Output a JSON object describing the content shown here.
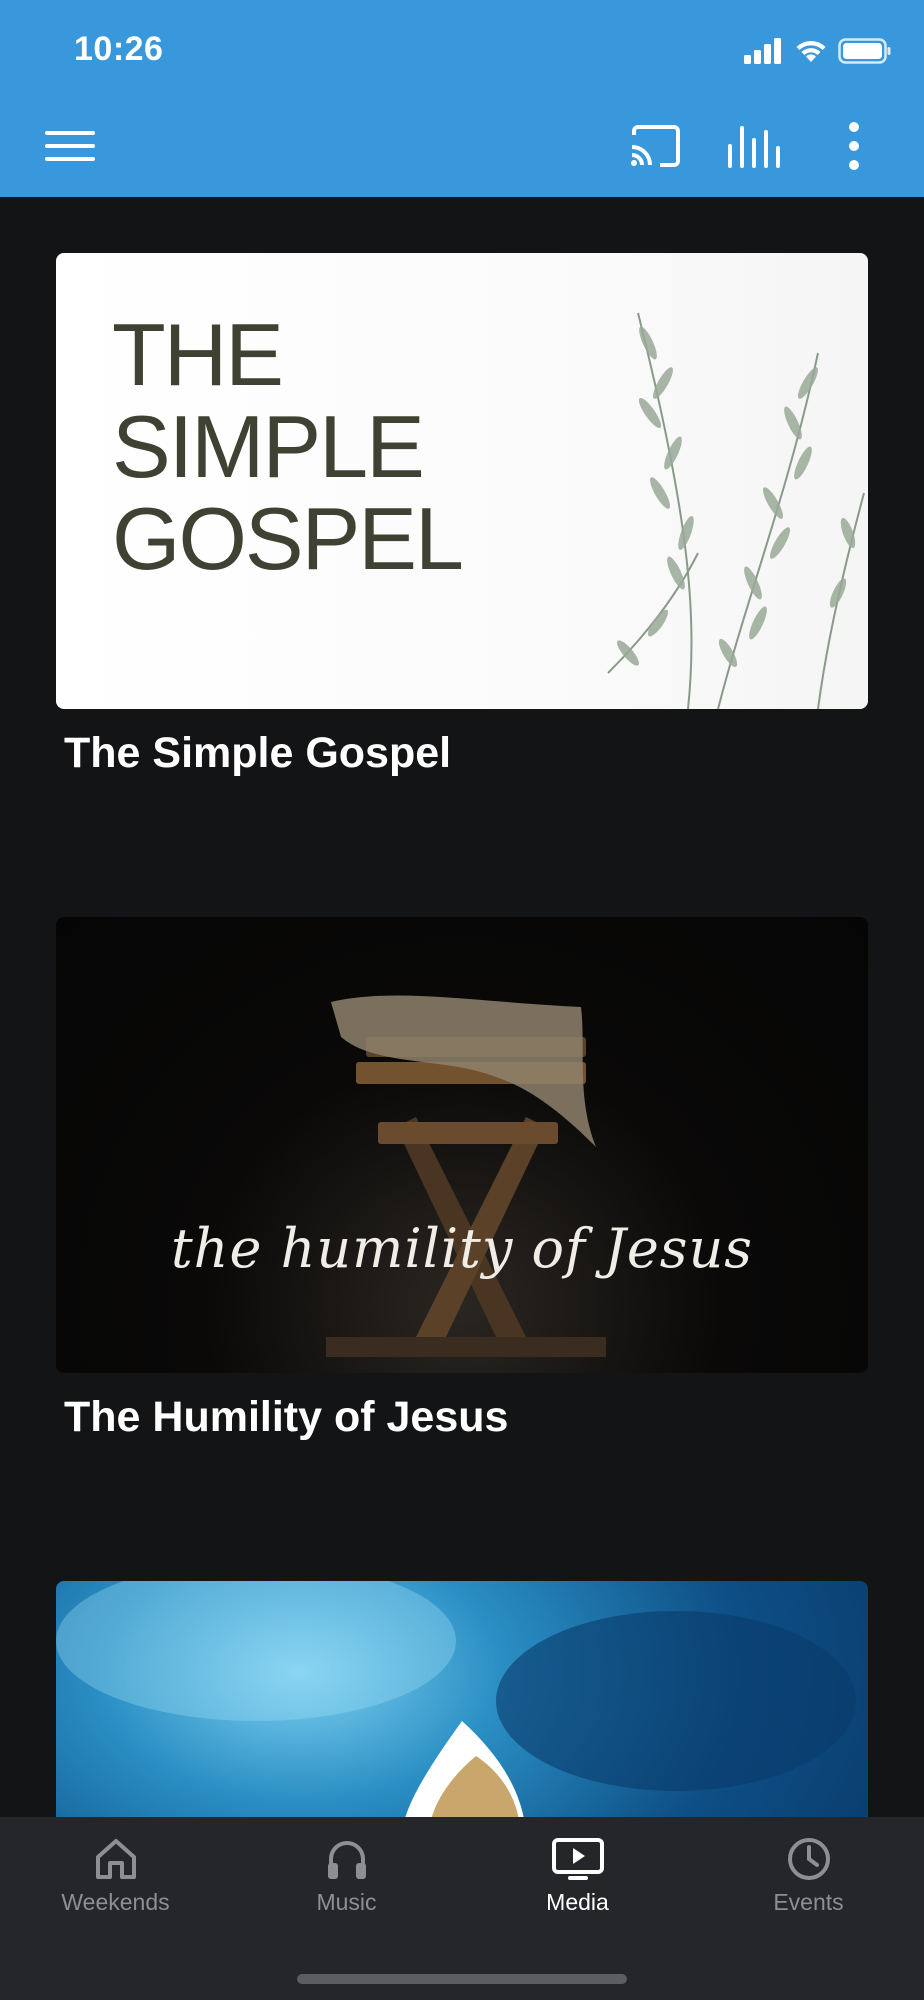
{
  "status_bar": {
    "time": "10:26"
  },
  "toolbar": {
    "menu_icon": "hamburger-menu-icon",
    "cast_icon": "cast-icon",
    "equalizer_icon": "equalizer-icon",
    "more_icon": "more-vertical-icon",
    "background_color": "#3898db"
  },
  "series": [
    {
      "title": "The Simple Gospel",
      "artwork_text": [
        "THE",
        "SIMPLE",
        "GOSPEL"
      ]
    },
    {
      "title": "The Humility of Jesus",
      "artwork_text": "the humility of Jesus"
    },
    {
      "title": "",
      "artwork_icon": "flame-logo-icon"
    }
  ],
  "tabs": [
    {
      "label": "Weekends",
      "icon": "home-icon",
      "active": false
    },
    {
      "label": "Music",
      "icon": "headphones-icon",
      "active": false
    },
    {
      "label": "Media",
      "icon": "tv-play-icon",
      "active": true
    },
    {
      "label": "Events",
      "icon": "clock-icon",
      "active": false
    }
  ]
}
